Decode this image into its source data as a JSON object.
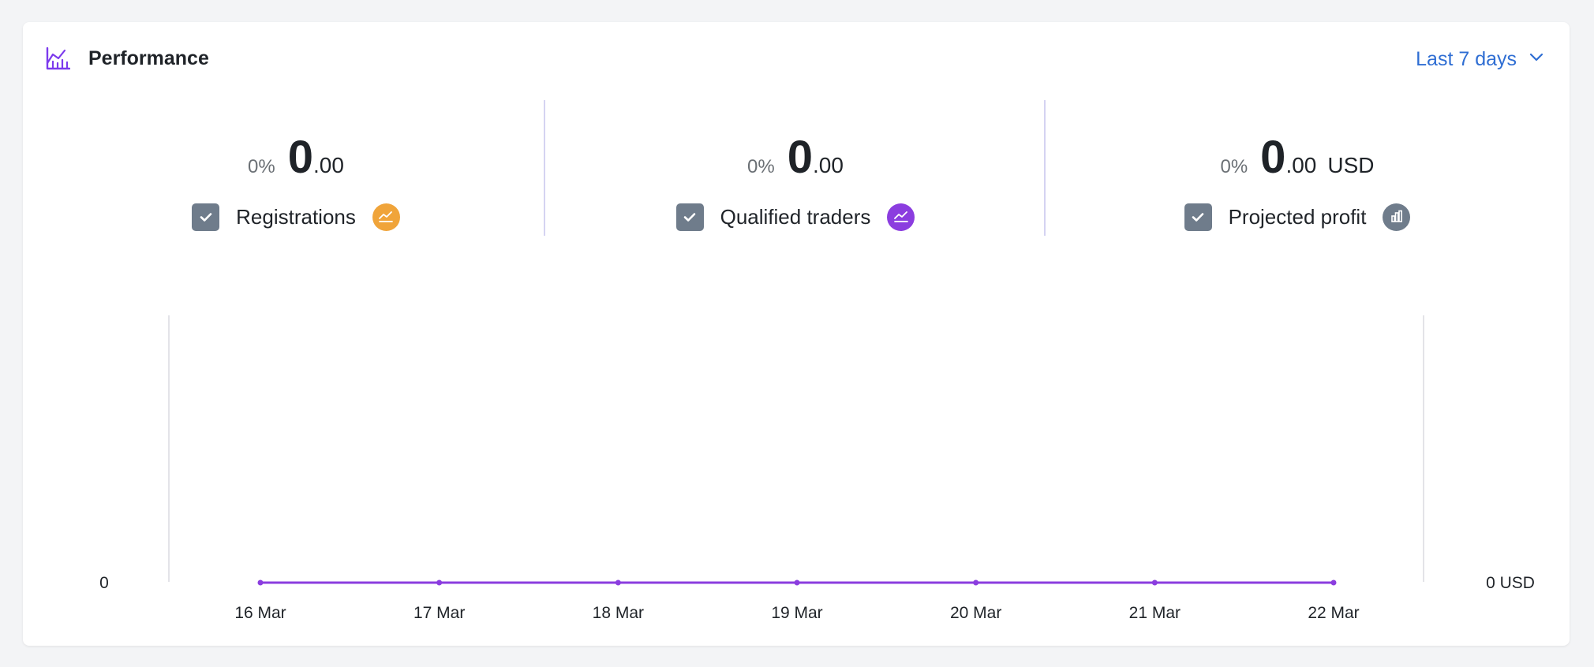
{
  "header": {
    "title": "Performance",
    "icon": "bar-chart-icon",
    "range_label": "Last 7 days",
    "accent": "#7c3aed",
    "link_color": "#2f6ed3"
  },
  "metrics": [
    {
      "pct": "0%",
      "int": "0",
      "dec": ".00",
      "unit": "",
      "label": "Registrations",
      "checked": true,
      "badge_icon": "area-chart-icon",
      "badge_color": "#f0a43a"
    },
    {
      "pct": "0%",
      "int": "0",
      "dec": ".00",
      "unit": "",
      "label": "Qualified traders",
      "checked": true,
      "badge_icon": "area-chart-icon",
      "badge_color": "#8b3ddf"
    },
    {
      "pct": "0%",
      "int": "0",
      "dec": ".00",
      "unit": "USD",
      "label": "Projected profit",
      "checked": true,
      "badge_icon": "bar-chart-icon",
      "badge_color": "#6f7c8b"
    }
  ],
  "chart_data": {
    "type": "line",
    "categories": [
      "16 Mar",
      "17 Mar",
      "18 Mar",
      "19 Mar",
      "20 Mar",
      "21 Mar",
      "22 Mar"
    ],
    "series": [
      {
        "values": [
          0,
          0,
          0,
          0,
          0,
          0,
          0
        ],
        "color": "#8b3ddf"
      }
    ],
    "y_left_label": "0",
    "y_right_label": "0 USD",
    "ylim": [
      0,
      1
    ],
    "grid": false
  }
}
